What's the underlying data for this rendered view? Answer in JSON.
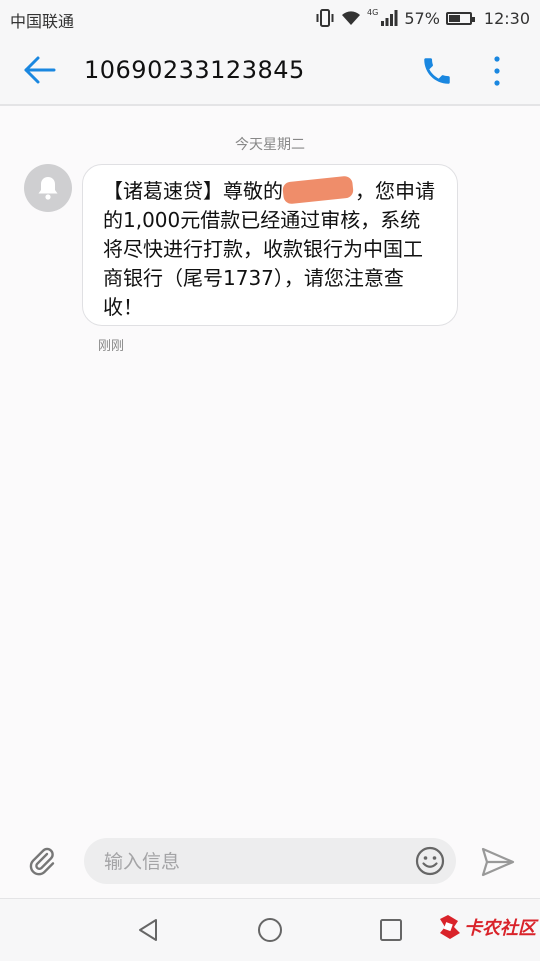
{
  "status_bar": {
    "carrier": "中国联通",
    "network_type": "4G",
    "battery_percent": "57%",
    "battery_level": 0.57,
    "time": "12:30"
  },
  "header": {
    "title": "10690233123845"
  },
  "conversation": {
    "date_label": "今天星期二",
    "message": {
      "text_before": "【诸葛速贷】尊敬的",
      "text_after": "，您申请的1,000元借款已经通过审核，系统将尽快进行打款，收款银行为中国工商银行（尾号1737），请您注意查收！",
      "time": "刚刚"
    }
  },
  "composer": {
    "placeholder": "输入信息"
  },
  "watermark": {
    "text": "卡农社区"
  },
  "colors": {
    "accent": "#1a87e0",
    "redaction": "#ef8d6a",
    "watermark": "#d9232a"
  }
}
